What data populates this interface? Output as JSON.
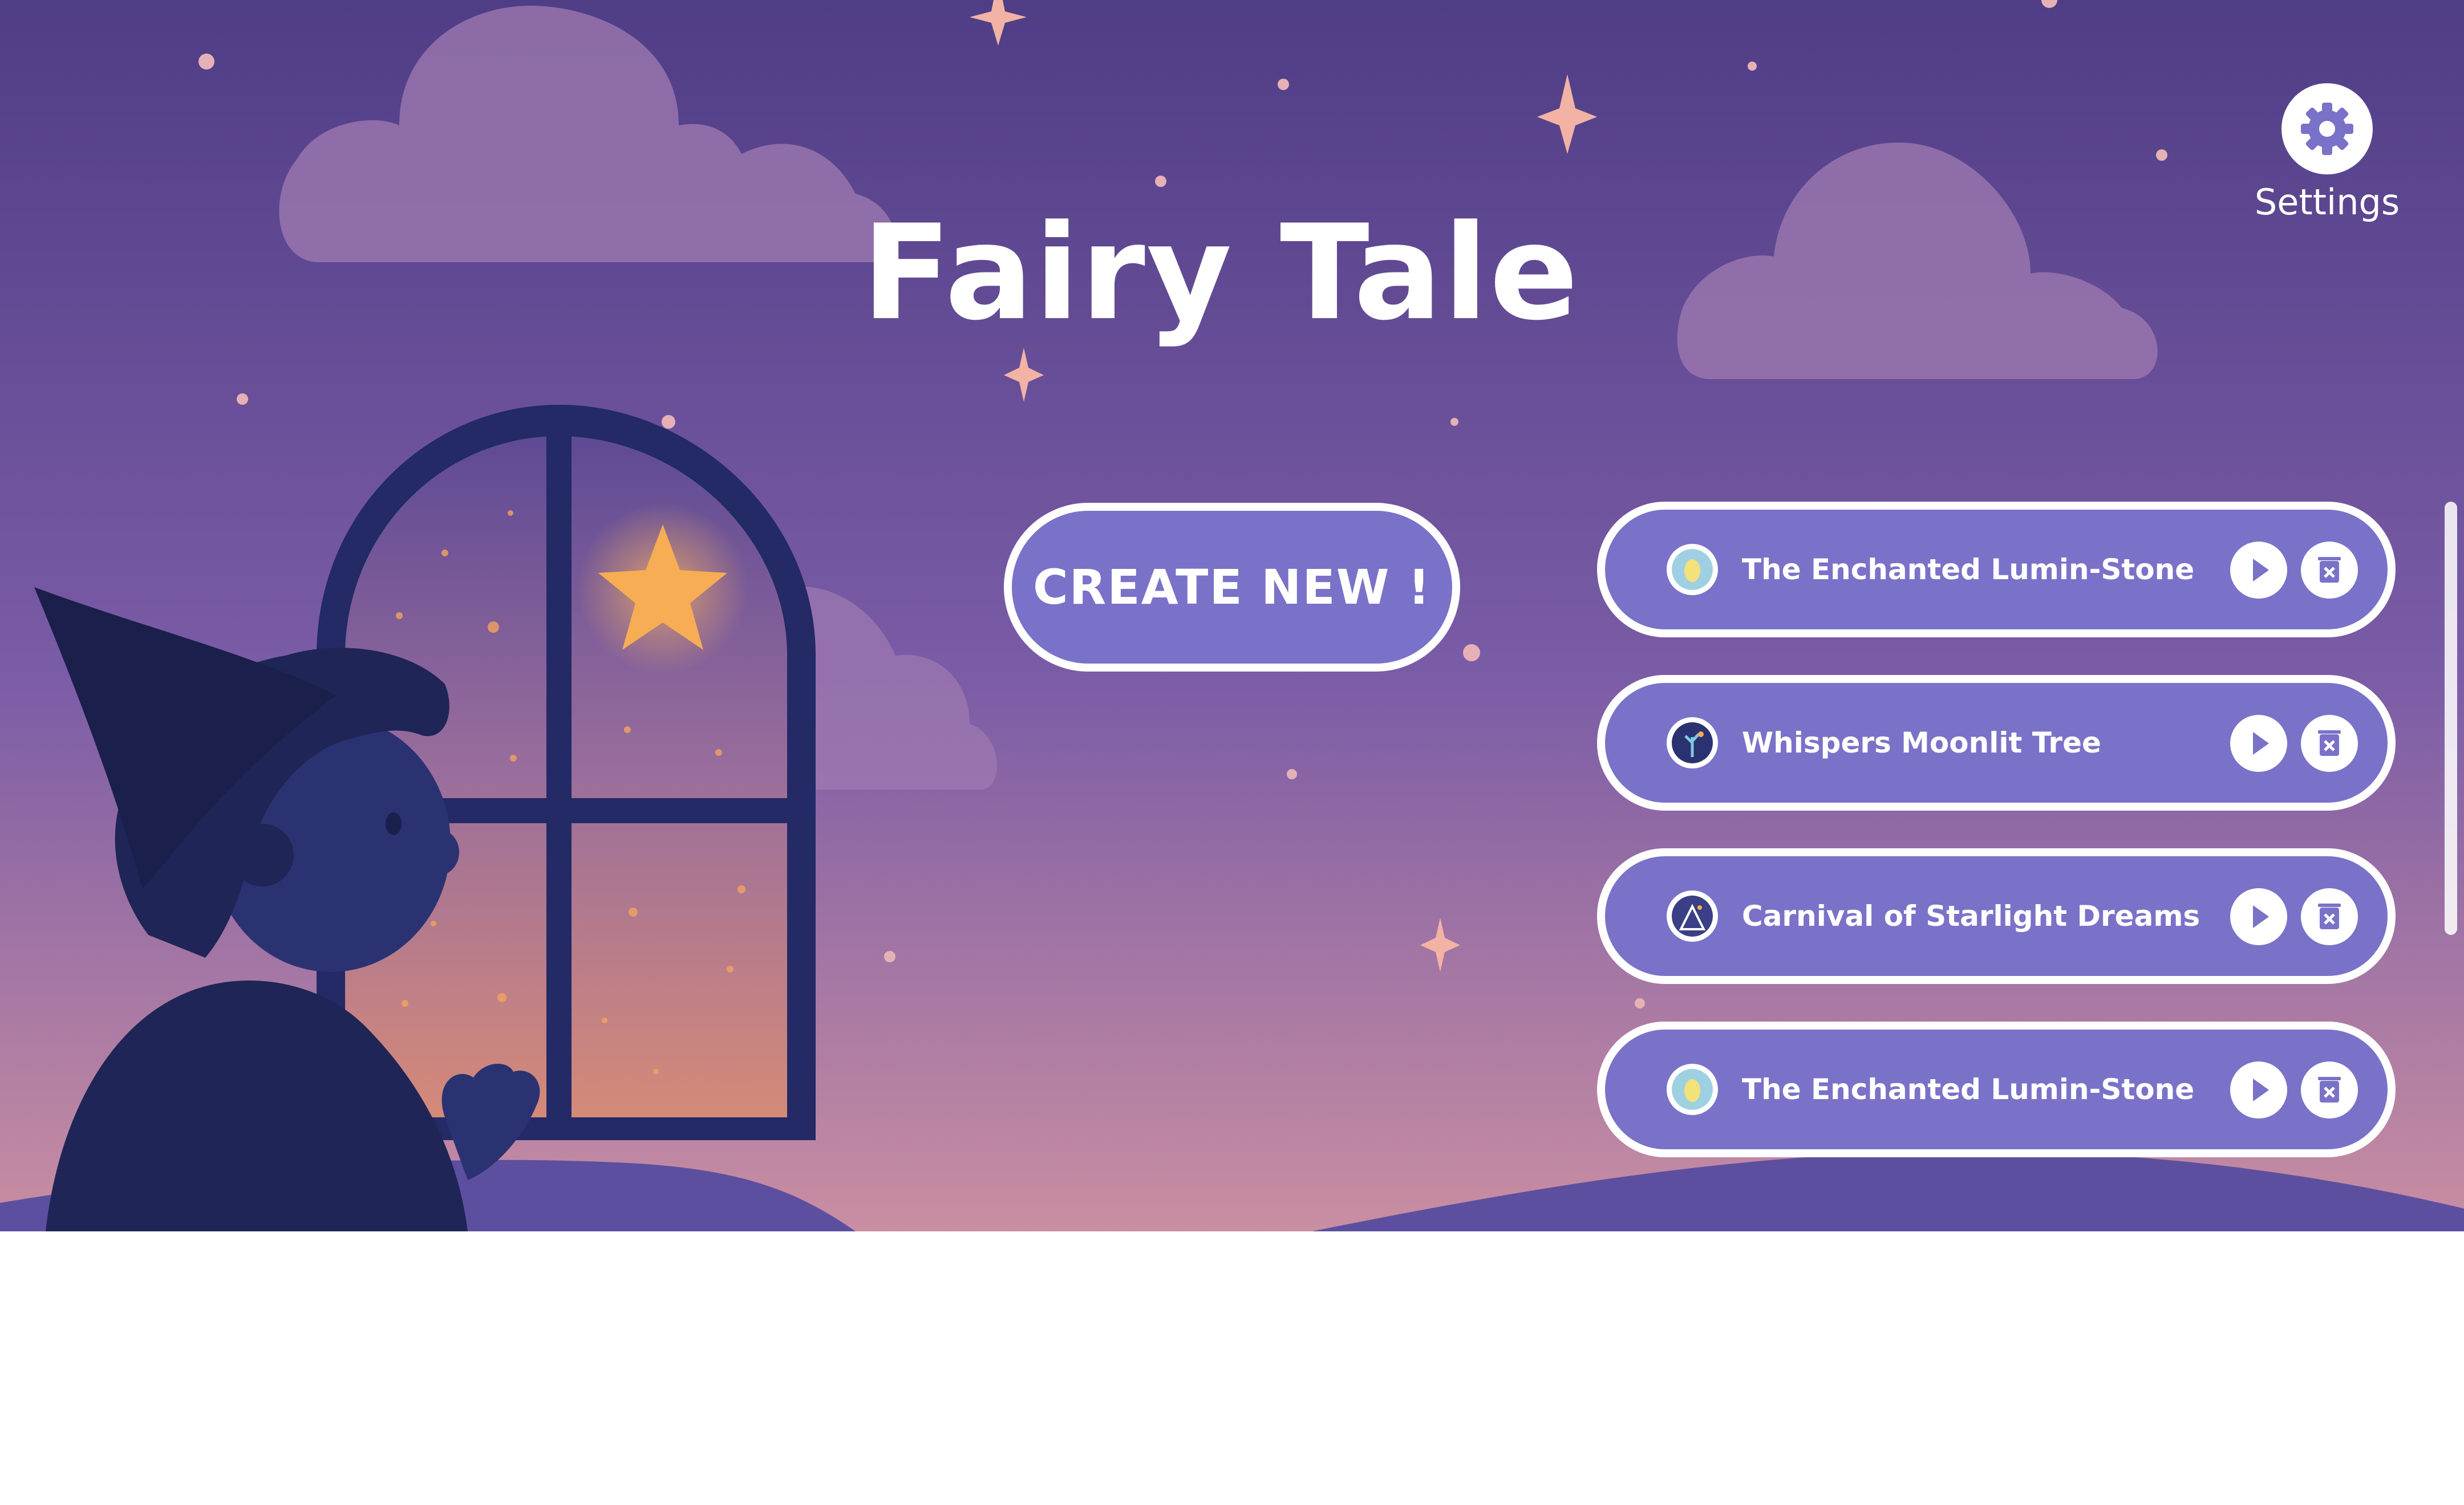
{
  "app": {
    "title": "Fairy Tale"
  },
  "settings": {
    "label": "Settings",
    "icon": "gear-icon"
  },
  "create_button": {
    "label": "CREATE NEW !"
  },
  "stories": [
    {
      "title": "The Enchanted Lumin-Stone",
      "thumb_icon": "lumin-stone-thumbnail"
    },
    {
      "title": "Whispers Moonlit Tree",
      "thumb_icon": "moonlit-tree-thumbnail"
    },
    {
      "title": "Carnival of Starlight Dreams",
      "thumb_icon": "starlight-carnival-thumbnail"
    },
    {
      "title": "The Enchanted Lumin-Stone",
      "thumb_icon": "lumin-stone-thumbnail"
    }
  ],
  "story_actions": {
    "play_icon": "play-icon",
    "delete_icon": "delete-icon"
  },
  "colors": {
    "sky_top": "#4f3d86",
    "sky_mid": "#7b5ca6",
    "sky_bottom": "#c98ea2",
    "button_fill": "#7a72c8",
    "button_border": "#ffffff",
    "hill": "#5d4f9f",
    "silhouette": "#1f2556",
    "star_glow": "#f6ad54"
  }
}
